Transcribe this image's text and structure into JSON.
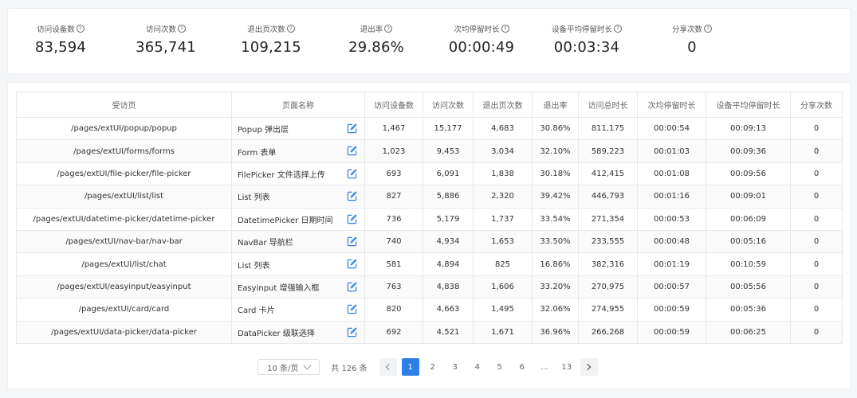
{
  "stats": [
    {
      "label": "访问设备数",
      "value": "83,594"
    },
    {
      "label": "访问次数",
      "value": "365,741"
    },
    {
      "label": "退出页次数",
      "value": "109,215"
    },
    {
      "label": "退出率",
      "value": "29.86%"
    },
    {
      "label": "次均停留时长",
      "value": "00:00:49"
    },
    {
      "label": "设备平均停留时长",
      "value": "00:03:34"
    },
    {
      "label": "分享次数",
      "value": "0"
    }
  ],
  "help_glyph": "?",
  "table": {
    "headers": [
      "受访页",
      "页面名称",
      "访问设备数",
      "访问次数",
      "退出页次数",
      "退出率",
      "访问总时长",
      "次均停留时长",
      "设备平均停留时长",
      "分享次数"
    ],
    "rows": [
      [
        "/pages/extUI/popup/popup",
        "Popup 弹出层",
        "1,467",
        "15,177",
        "4,683",
        "30.86%",
        "811,175",
        "00:00:54",
        "00:09:13",
        "0"
      ],
      [
        "/pages/extUI/forms/forms",
        "Form 表单",
        "1,023",
        "9,453",
        "3,034",
        "32.10%",
        "589,223",
        "00:01:03",
        "00:09:36",
        "0"
      ],
      [
        "/pages/extUI/file-picker/file-picker",
        "FilePicker 文件选择上传",
        "693",
        "6,091",
        "1,838",
        "30.18%",
        "412,415",
        "00:01:08",
        "00:09:56",
        "0"
      ],
      [
        "/pages/extUI/list/list",
        "List 列表",
        "827",
        "5,886",
        "2,320",
        "39.42%",
        "446,793",
        "00:01:16",
        "00:09:01",
        "0"
      ],
      [
        "/pages/extUI/datetime-picker/datetime-picker",
        "DatetimePicker 日期时间",
        "736",
        "5,179",
        "1,737",
        "33.54%",
        "271,354",
        "00:00:53",
        "00:06:09",
        "0"
      ],
      [
        "/pages/extUI/nav-bar/nav-bar",
        "NavBar 导航栏",
        "740",
        "4,934",
        "1,653",
        "33.50%",
        "233,555",
        "00:00:48",
        "00:05:16",
        "0"
      ],
      [
        "/pages/extUI/list/chat",
        "List 列表",
        "581",
        "4,894",
        "825",
        "16.86%",
        "382,316",
        "00:01:19",
        "00:10:59",
        "0"
      ],
      [
        "/pages/extUI/easyinput/easyinput",
        "Easyinput 增强输入框",
        "763",
        "4,838",
        "1,606",
        "33.20%",
        "270,975",
        "00:00:57",
        "00:05:56",
        "0"
      ],
      [
        "/pages/extUI/card/card",
        "Card 卡片",
        "820",
        "4,663",
        "1,495",
        "32.06%",
        "274,955",
        "00:00:59",
        "00:05:36",
        "0"
      ],
      [
        "/pages/extUI/data-picker/data-picker",
        "DataPicker 级联选择",
        "692",
        "4,521",
        "1,671",
        "36.96%",
        "266,268",
        "00:00:59",
        "00:06:25",
        "0"
      ]
    ]
  },
  "pagination": {
    "page_size": "10 条/页",
    "total": "共 126 条",
    "pages": [
      "1",
      "2",
      "3",
      "4",
      "5",
      "6",
      "...",
      "13"
    ],
    "current": "1"
  },
  "colors": {
    "accent": "#2f7fe8",
    "edit_icon": "#2f7fe8"
  }
}
